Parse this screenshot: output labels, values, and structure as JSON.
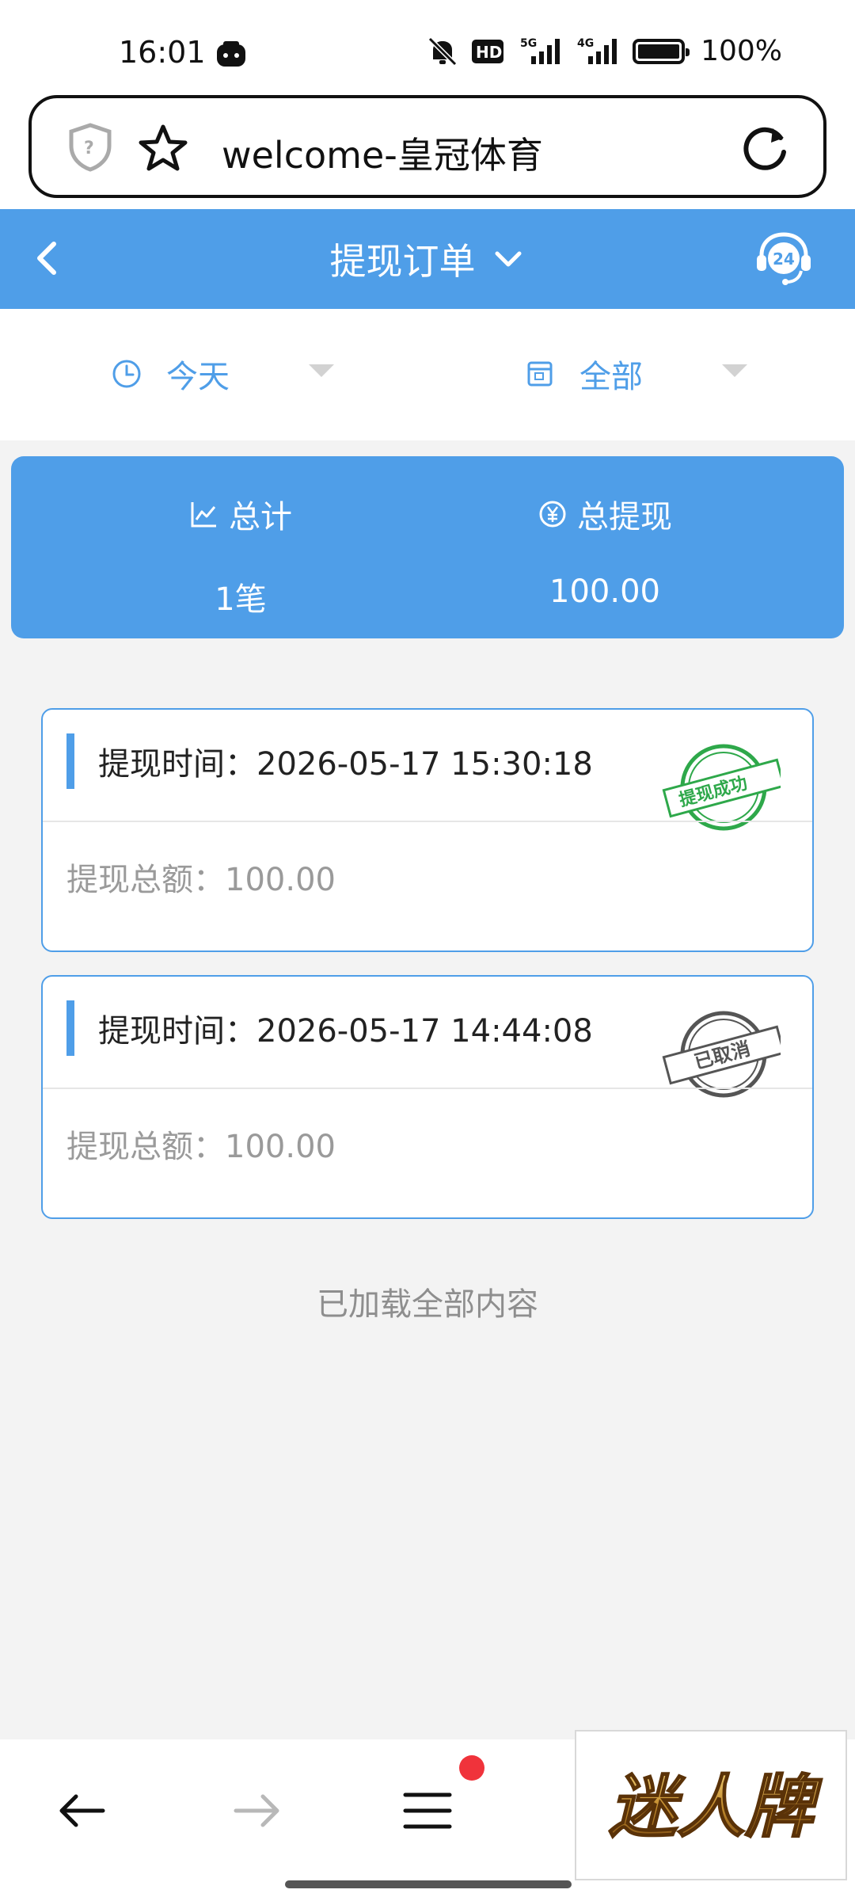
{
  "status_bar": {
    "time": "16:01",
    "network_hd": "HD",
    "net_5g": "5G",
    "net_4g": "4G",
    "battery": "100%"
  },
  "browser": {
    "url_text": "welcome-皇冠体育",
    "forward_enabled": false,
    "menu_has_notification": true
  },
  "header": {
    "title": "提现订单",
    "support_badge": "24"
  },
  "filters": {
    "date_label": "今天",
    "type_label": "全部"
  },
  "summary": {
    "total_label": "总计",
    "total_value": "1笔",
    "withdraw_label": "总提现",
    "withdraw_value": "100.00"
  },
  "orders": [
    {
      "time_label": "提现时间：",
      "time_value": "2026-05-17 15:30:18",
      "amount_label": "提现总额：",
      "amount_value": "100.00",
      "stamp_text": "提现成功",
      "stamp_color": "#2ea84a"
    },
    {
      "time_label": "提现时间：",
      "time_value": "2026-05-17 14:44:08",
      "amount_label": "提现总额：",
      "amount_value": "100.00",
      "stamp_text": "已取消",
      "stamp_color": "#555555"
    }
  ],
  "footer_text": "已加载全部内容",
  "ad": {
    "text": "迷人牌"
  },
  "colors": {
    "accent": "#4f9ee8",
    "notification": "#f0333b"
  }
}
